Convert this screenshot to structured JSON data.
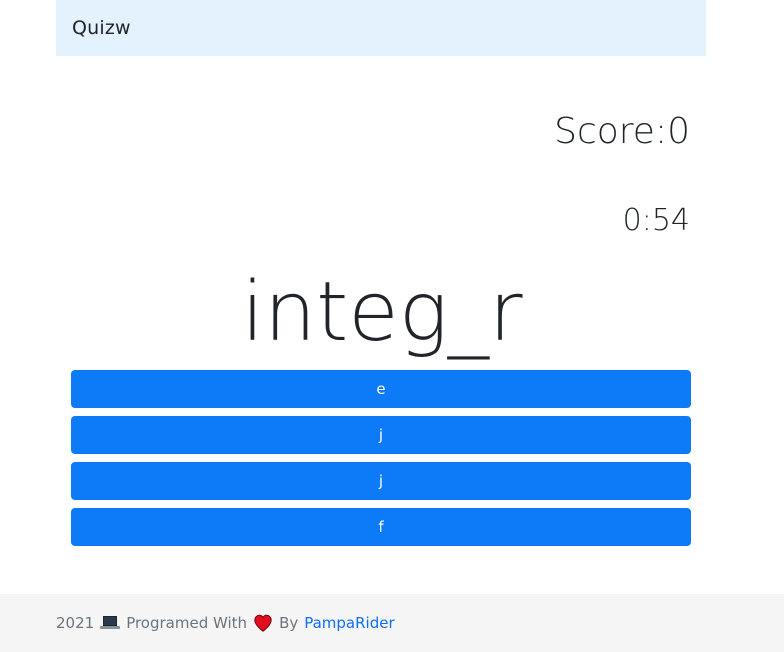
{
  "navbar": {
    "brand": "Quizw"
  },
  "quiz": {
    "score_label": "Score:0",
    "timer": "0:54",
    "word": "integ_r",
    "answers": [
      "e",
      "j",
      "j",
      "f"
    ]
  },
  "footer": {
    "year": "2021",
    "laptop_icon": "laptop-icon",
    "text_with": "Programed With",
    "heart_icon": "heart-icon",
    "text_by": "By",
    "author": "PampaRider"
  },
  "colors": {
    "navbar_bg": "#e3f2fd",
    "button_bg": "#0d7bf7",
    "footer_bg": "#f5f5f5",
    "link": "#0d6efd",
    "heart": "#e0101e"
  }
}
